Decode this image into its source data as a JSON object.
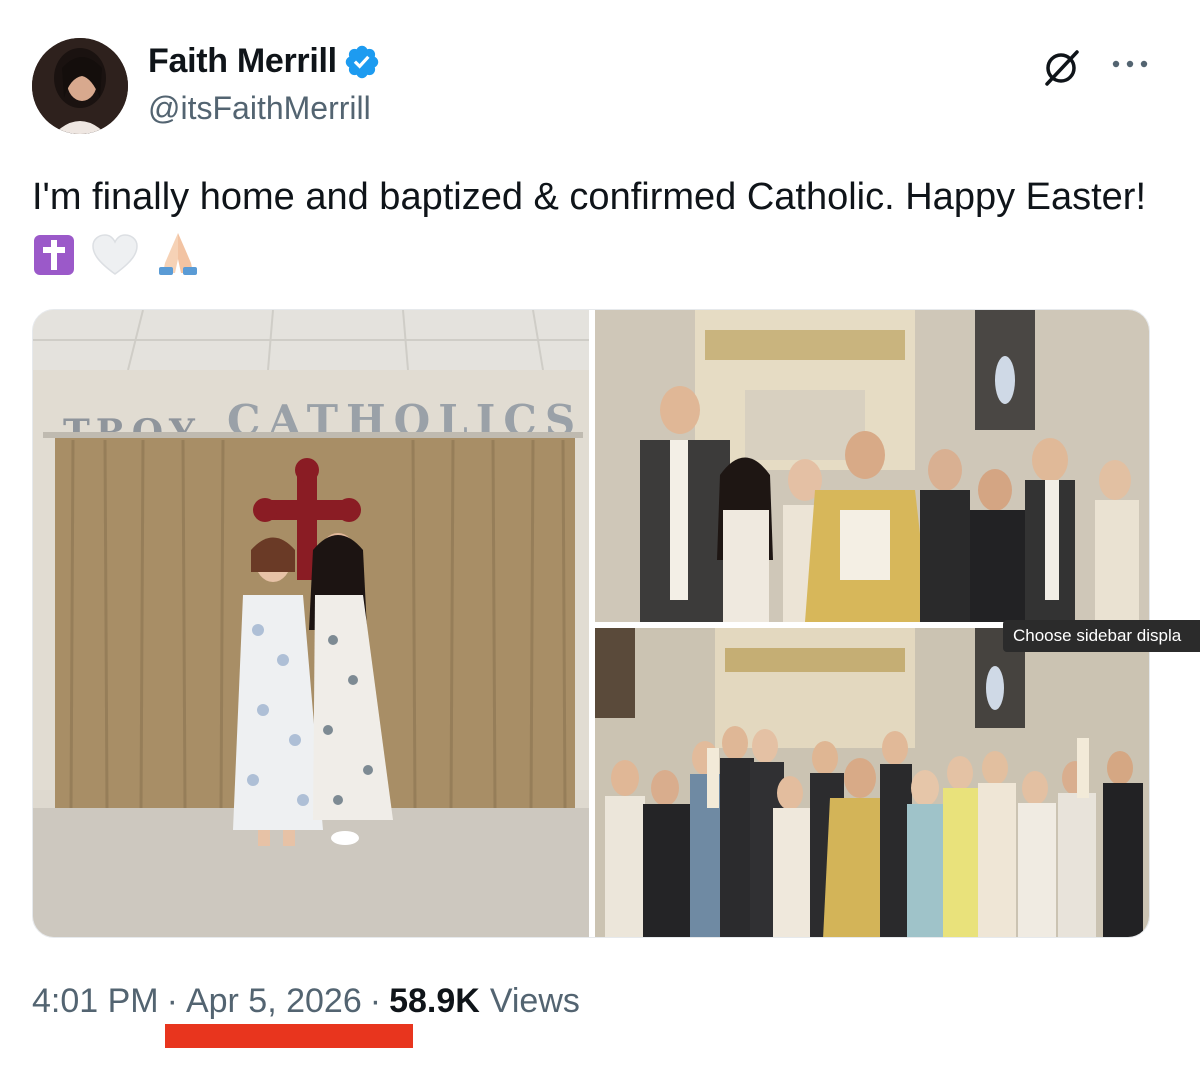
{
  "author": {
    "display_name": "Faith Merrill",
    "handle": "@itsFaithMerrill",
    "verified": true
  },
  "tweet": {
    "text": "I'm finally home and baptized & confirmed Catholic. Happy Easter!",
    "emojis": [
      "latin-cross-emoji",
      "white-heart-emoji",
      "folded-hands-emoji"
    ]
  },
  "media": {
    "photo_1": {
      "sign_line_1": "TROY",
      "sign_line_2": "CATHOLICS"
    }
  },
  "tooltip": {
    "text": "Choose sidebar displa"
  },
  "metadata": {
    "time": "4:01 PM",
    "separator": "·",
    "date": "Apr 5, 2026",
    "views_count": "58.9K",
    "views_label": "Views"
  },
  "colors": {
    "verified_blue": "#1d9bf0",
    "secondary_text": "#536471",
    "primary_text": "#0f1419",
    "annotation_red": "#e8351e"
  }
}
